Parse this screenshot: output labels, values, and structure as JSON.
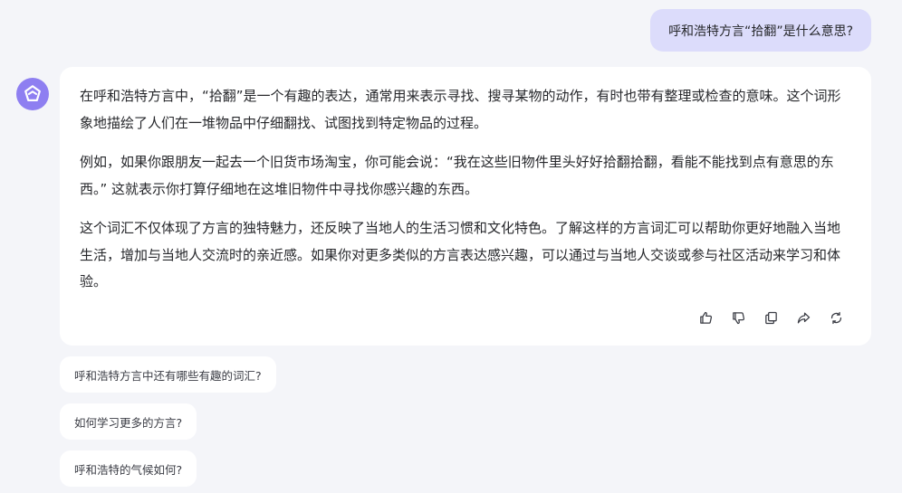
{
  "user_message": {
    "text": "呼和浩特方言“拾翻”是什么意思?"
  },
  "assistant": {
    "avatar_icon": "assistant-logo-icon",
    "paragraphs": [
      "在呼和浩特方言中，“拾翻”是一个有趣的表达，通常用来表示寻找、搜寻某物的动作，有时也带有整理或检查的意味。这个词形象地描绘了人们在一堆物品中仔细翻找、试图找到特定物品的过程。",
      "例如，如果你跟朋友一起去一个旧货市场淘宝，你可能会说：“我在这些旧物件里头好好拾翻拾翻，看能不能找到点有意思的东西。” 这就表示你打算仔细地在这堆旧物件中寻找你感兴趣的东西。",
      "这个词汇不仅体现了方言的独特魅力，还反映了当地人的生活习惯和文化特色。了解这样的方言词汇可以帮助你更好地融入当地生活，增加与当地人交流时的亲近感。如果你对更多类似的方言表达感兴趣，可以通过与当地人交谈或参与社区活动来学习和体验。"
    ],
    "actions": [
      "thumbs-up-icon",
      "thumbs-down-icon",
      "copy-icon",
      "share-icon",
      "regenerate-icon"
    ]
  },
  "suggestions": [
    "呼和浩特方言中还有哪些有趣的词汇?",
    "如何学习更多的方言?",
    "呼和浩特的气候如何?"
  ],
  "colors": {
    "page_background": "#f4f5f9",
    "user_bubble": "#dcdcfb",
    "avatar": "#8e7ff1",
    "card": "#ffffff"
  }
}
